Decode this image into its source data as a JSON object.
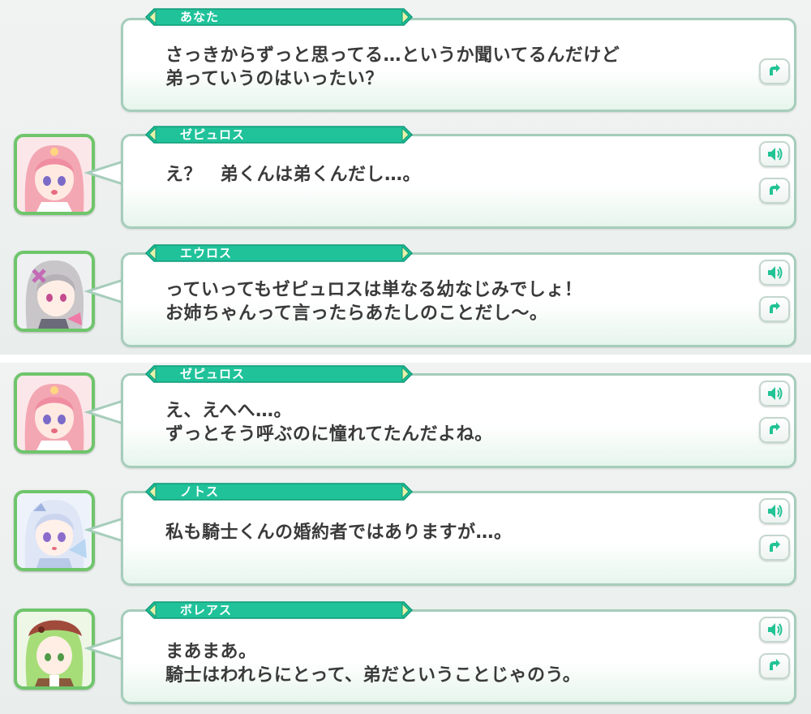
{
  "accent_color": "#20c29a",
  "avatar_border_color": "#6fc56b",
  "rows": [
    {
      "speaker": "あなた",
      "avatar": null,
      "lines": [
        "さっきからずっと思ってる…というか聞いてるんだけど",
        "弟っていうのはいったい？"
      ],
      "voice_icon": null,
      "replay_icon": "replay-icon"
    },
    {
      "speaker": "ゼピュロス",
      "avatar": "zephyros-avatar",
      "lines": [
        "え？　弟くんは弟くんだし…。"
      ],
      "voice_icon": "speaker-icon",
      "replay_icon": "replay-icon"
    },
    {
      "speaker": "エウロス",
      "avatar": "euros-avatar",
      "lines": [
        "っていってもゼピュロスは単なる幼なじみでしょ！",
        "お姉ちゃんって言ったらあたしのことだし～。"
      ],
      "voice_icon": "speaker-icon",
      "replay_icon": "replay-icon"
    },
    {
      "speaker": "ゼピュロス",
      "avatar": "zephyros-avatar",
      "lines": [
        "え、えへへ…。",
        "ずっとそう呼ぶのに憧れてたんだよね。"
      ],
      "voice_icon": "speaker-icon",
      "replay_icon": "replay-icon"
    },
    {
      "speaker": "ノトス",
      "avatar": "notos-avatar",
      "lines": [
        "私も騎士くんの婚約者ではありますが…。"
      ],
      "voice_icon": "speaker-icon",
      "replay_icon": "replay-icon"
    },
    {
      "speaker": "ボレアス",
      "avatar": "boreas-avatar",
      "lines": [
        "まあまあ。",
        "騎士はわれらにとって、弟だということじゃのう。"
      ],
      "voice_icon": "speaker-icon",
      "replay_icon": "replay-icon"
    }
  ]
}
